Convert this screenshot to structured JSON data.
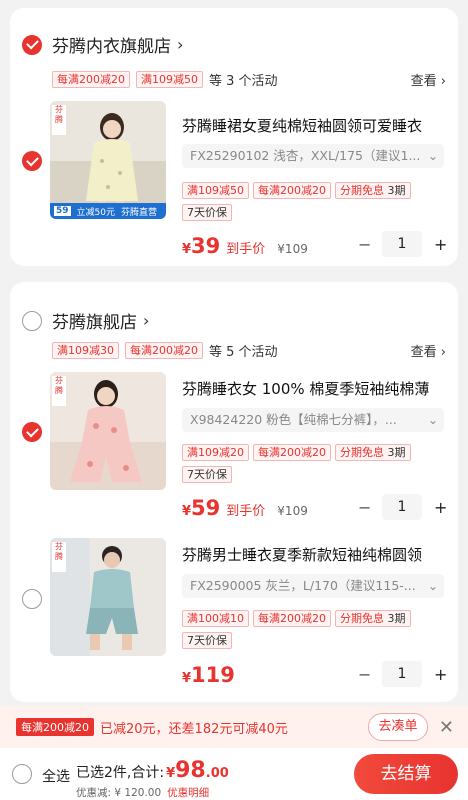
{
  "stores": [
    {
      "name": "芬腾内衣旗舰店",
      "checked": true,
      "promo_tags": [
        "每满200减20",
        "满109减50"
      ],
      "promo_more": "等 3 个活动",
      "see_all": "查看 ›",
      "items": [
        {
          "title": "芬腾睡裙女夏纯棉短袖圆领可爱睡衣",
          "sku": "FX25290102 浅杏，XXL/175（建议1...",
          "tags": [
            {
              "text": "满109减50"
            },
            {
              "text": "每满200减20"
            },
            {
              "pre": "分期免息",
              "post": " 3期"
            },
            {
              "text": "7天价保",
              "gray": true
            }
          ],
          "price_int": "39",
          "price_label": "到手价",
          "orig_price": "¥109",
          "qty": "1",
          "checked": true,
          "thumb_strip": {
            "num": "59",
            "text1": "立减50元",
            "text2": "芬腾直营"
          }
        }
      ]
    },
    {
      "name": "芬腾旗舰店",
      "checked": false,
      "promo_tags": [
        "满109减30",
        "每满200减20"
      ],
      "promo_more": "等 5 个活动",
      "see_all": "查看 ›",
      "items": [
        {
          "title": "芬腾睡衣女 100% 棉夏季短袖纯棉薄",
          "sku": "X98424220 粉色【纯棉七分裤】，...",
          "tags": [
            {
              "text": "满109减20"
            },
            {
              "text": "每满200减20"
            },
            {
              "pre": "分期免息",
              "post": " 3期"
            },
            {
              "text": "7天价保",
              "gray": true
            }
          ],
          "price_int": "59",
          "price_label": "到手价",
          "orig_price": "¥109",
          "qty": "1",
          "checked": true
        },
        {
          "title": "芬腾男士睡衣夏季新款短袖纯棉圆领",
          "sku": "FX2590005 灰兰，L/170（建议115-...",
          "tags": [
            {
              "text": "满100减10"
            },
            {
              "text": "每满200减20"
            },
            {
              "pre": "分期免息",
              "post": " 3期"
            },
            {
              "text": "7天价保",
              "gray": true
            }
          ],
          "price_int": "119",
          "qty": "1",
          "checked": false
        }
      ]
    }
  ],
  "promo_bar": {
    "tag": "每满200减20",
    "text": "已减20元，还差182元可减40元",
    "button": "去凑单",
    "close": "✕"
  },
  "bottom_bar": {
    "select_all": "全选",
    "summary_prefix": "已选2件,合计:",
    "currency": "¥",
    "total_int": "98",
    "total_dec": ".00",
    "discount_text": "优惠减: ¥ 120.00",
    "discount_detail": "优惠明细",
    "checkout": "去结算"
  },
  "colors": {
    "accent": "#e8332f",
    "bg": "#f2f2f2"
  }
}
